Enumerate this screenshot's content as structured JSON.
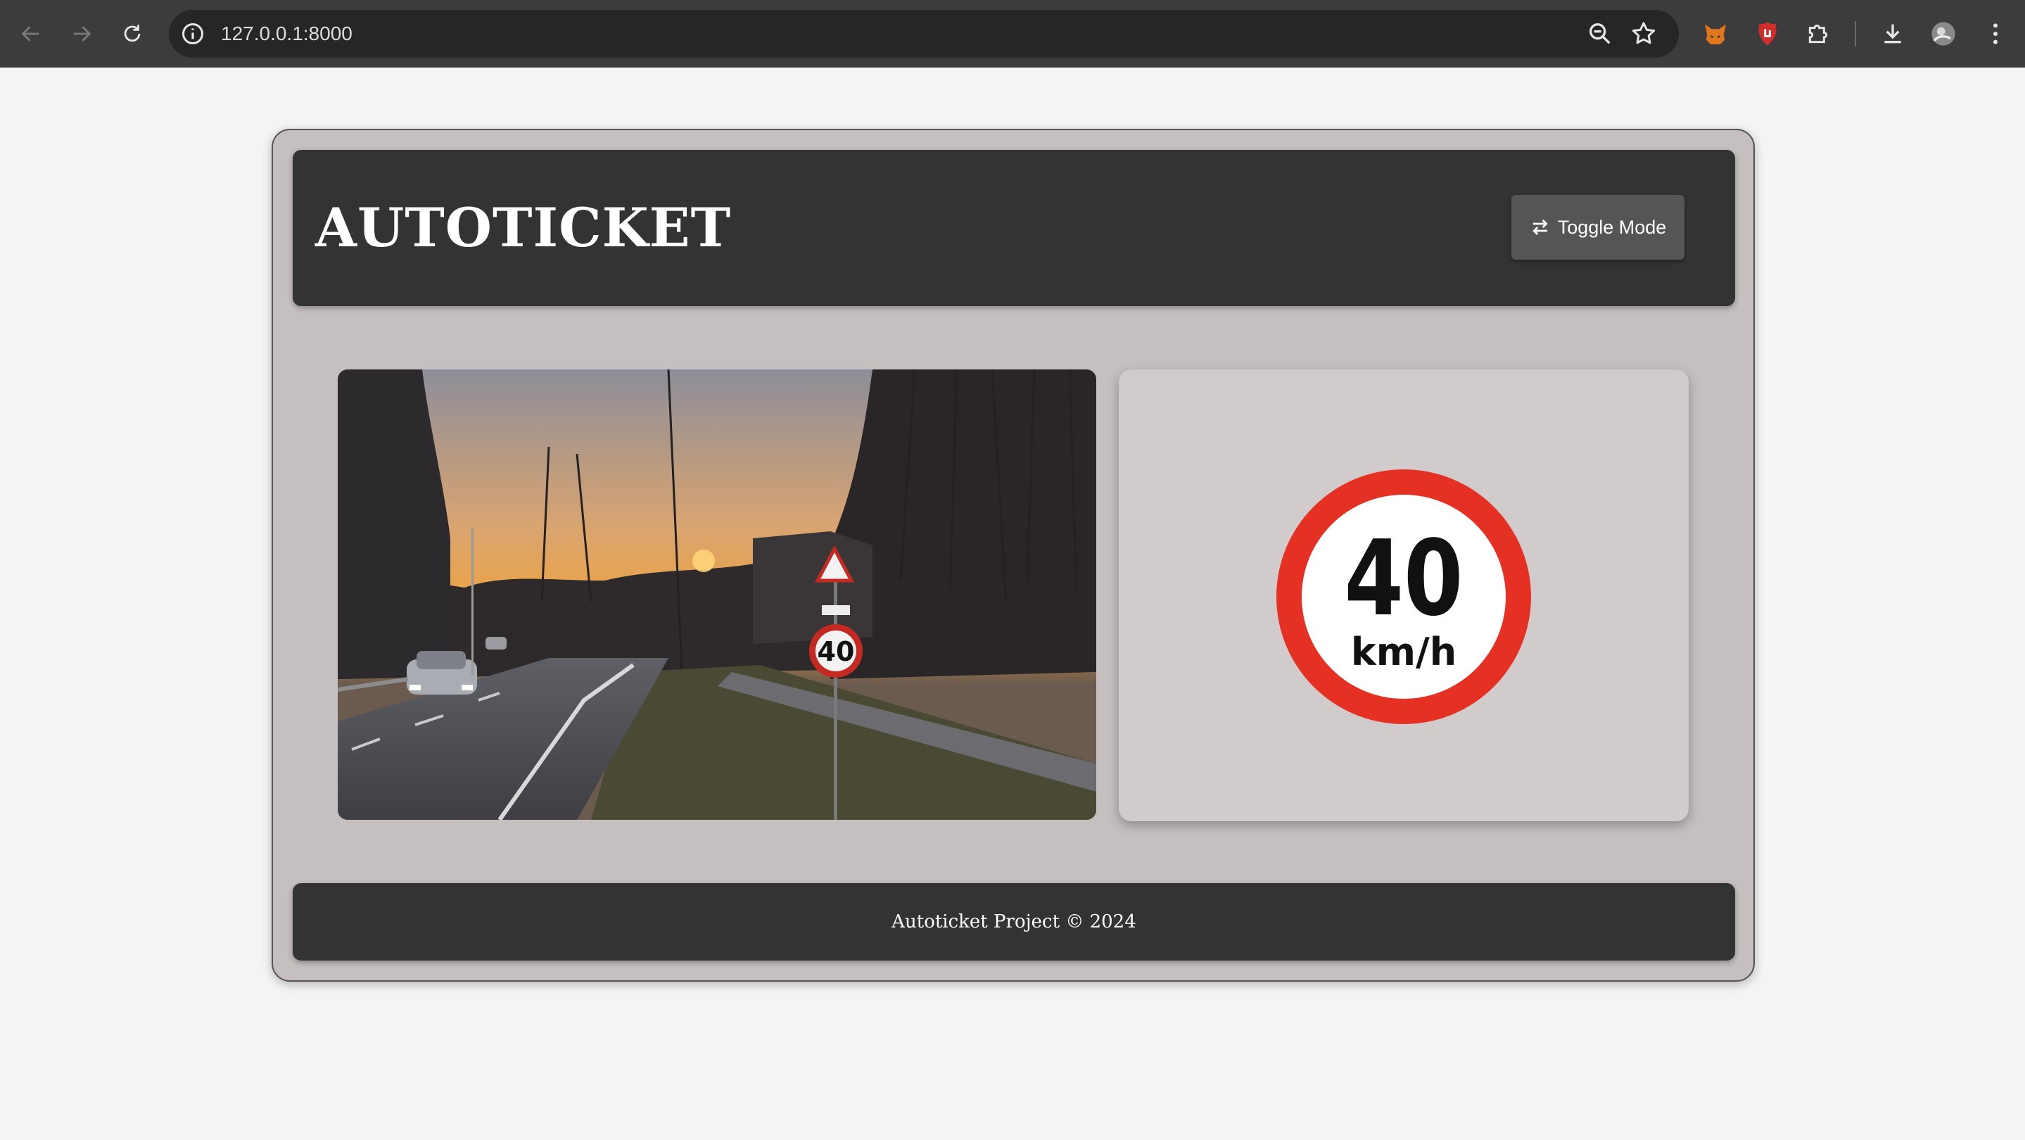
{
  "browser": {
    "url": "127.0.0.1:8000",
    "icons": [
      "back-icon",
      "forward-icon",
      "reload-icon",
      "site-info-icon",
      "zoom-icon",
      "bookmark-star-icon",
      "fox-extension-icon",
      "shield-extension-icon",
      "puzzle-extension-icon",
      "download-icon",
      "profile-avatar",
      "kebab-menu-icon"
    ]
  },
  "header": {
    "title": "AUTOTICKET",
    "toggle_label": "Toggle Mode"
  },
  "detection": {
    "speed_limit": "40",
    "unit": "km/h",
    "sign_ring_color": "#e53124"
  },
  "footer": {
    "text": "Autoticket Project © 2024"
  },
  "colors": {
    "header_bg": "#333333",
    "app_bg": "#c5bfbf",
    "panel_bg": "#d1cbcb",
    "page_bg": "#f4f4f4"
  }
}
